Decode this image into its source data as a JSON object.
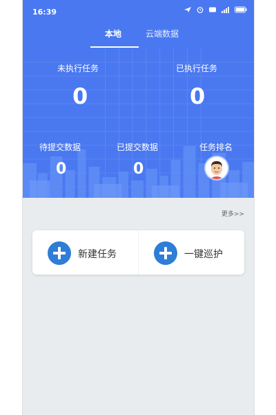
{
  "status_bar": {
    "time": "16:39",
    "icons": [
      "location-icon",
      "alarm-icon",
      "message-icon",
      "signal-icon",
      "battery-icon"
    ],
    "battery": "88"
  },
  "tabs": [
    {
      "label": "本地",
      "active": true
    },
    {
      "label": "云端数据",
      "active": false
    }
  ],
  "stats": {
    "unexecuted_label": "未执行任务",
    "unexecuted_value": "0",
    "executed_label": "已执行任务",
    "executed_value": "0",
    "pending_label": "待提交数据",
    "pending_value": "0",
    "submitted_label": "已提交数据",
    "submitted_value": "0",
    "rank_label": "任务排名"
  },
  "more_link": "更多>>",
  "actions": {
    "new_task": "新建任务",
    "one_click_patrol": "一键巡护"
  },
  "colors": {
    "hero_blue": "#4a78f0",
    "plus_blue": "#2e7dd6",
    "body_bg": "#e8ecee"
  }
}
